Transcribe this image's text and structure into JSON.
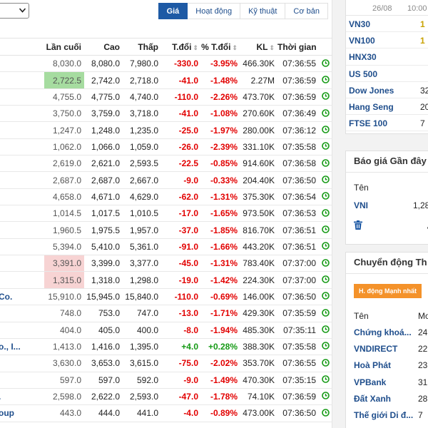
{
  "toolbar": {
    "tabs": [
      {
        "label": "Giá",
        "active": true
      },
      {
        "label": "Hoạt động",
        "active": false
      },
      {
        "label": "Kỹ thuật",
        "active": false
      },
      {
        "label": "Cơ bản",
        "active": false
      }
    ]
  },
  "table": {
    "headers": [
      "Lần cuối",
      "Cao",
      "Thấp",
      "T.đổi",
      "% T.đổi",
      "KL",
      "Thời gian"
    ],
    "rows": [
      {
        "name": "",
        "last": "8,030.0",
        "high": "8,080.0",
        "low": "7,980.0",
        "chg": "-330.0",
        "pct": "-3.95%",
        "vol": "466.30K",
        "time": "07:36:55",
        "hl": ""
      },
      {
        "name": "",
        "last": "2,722.5",
        "high": "2,742.0",
        "low": "2,718.0",
        "chg": "-41.0",
        "pct": "-1.48%",
        "vol": "2.27M",
        "time": "07:36:59",
        "hl": "green"
      },
      {
        "name": "",
        "last": "4,755.0",
        "high": "4,775.0",
        "low": "4,740.0",
        "chg": "-110.0",
        "pct": "-2.26%",
        "vol": "473.70K",
        "time": "07:36:59",
        "hl": ""
      },
      {
        "name": "",
        "last": "3,750.0",
        "high": "3,759.0",
        "low": "3,718.0",
        "chg": "-41.0",
        "pct": "-1.08%",
        "vol": "270.60K",
        "time": "07:36:49",
        "hl": ""
      },
      {
        "name": "",
        "last": "1,247.0",
        "high": "1,248.0",
        "low": "1,235.0",
        "chg": "-25.0",
        "pct": "-1.97%",
        "vol": "280.00K",
        "time": "07:36:12",
        "hl": ""
      },
      {
        "name": "",
        "last": "1,062.0",
        "high": "1,066.0",
        "low": "1,059.0",
        "chg": "-26.0",
        "pct": "-2.39%",
        "vol": "331.10K",
        "time": "07:35:58",
        "hl": ""
      },
      {
        "name": "",
        "last": "2,619.0",
        "high": "2,621.0",
        "low": "2,593.5",
        "chg": "-22.5",
        "pct": "-0.85%",
        "vol": "914.60K",
        "time": "07:36:58",
        "hl": ""
      },
      {
        "name": "",
        "last": "2,687.0",
        "high": "2,687.0",
        "low": "2,667.0",
        "chg": "-9.0",
        "pct": "-0.33%",
        "vol": "204.40K",
        "time": "07:36:50",
        "hl": ""
      },
      {
        "name": "",
        "last": "4,658.0",
        "high": "4,671.0",
        "low": "4,629.0",
        "chg": "-62.0",
        "pct": "-1.31%",
        "vol": "375.30K",
        "time": "07:36:54",
        "hl": ""
      },
      {
        "name": "",
        "last": "1,014.5",
        "high": "1,017.5",
        "low": "1,010.5",
        "chg": "-17.0",
        "pct": "-1.65%",
        "vol": "973.50K",
        "time": "07:36:53",
        "hl": ""
      },
      {
        "name": "",
        "last": "1,960.5",
        "high": "1,975.5",
        "low": "1,957.0",
        "chg": "-37.0",
        "pct": "-1.85%",
        "vol": "816.70K",
        "time": "07:36:51",
        "hl": ""
      },
      {
        "name": "",
        "last": "5,394.0",
        "high": "5,410.0",
        "low": "5,361.0",
        "chg": "-91.0",
        "pct": "-1.66%",
        "vol": "443.20K",
        "time": "07:36:51",
        "hl": ""
      },
      {
        "name": "",
        "last": "3,391.0",
        "high": "3,399.0",
        "low": "3,377.0",
        "chg": "-45.0",
        "pct": "-1.31%",
        "vol": "783.40K",
        "time": "07:37:00",
        "hl": "red"
      },
      {
        "name": "",
        "last": "1,315.0",
        "high": "1,318.0",
        "low": "1,298.0",
        "chg": "-19.0",
        "pct": "-1.42%",
        "vol": "224.30K",
        "time": "07:37:00",
        "hl": "red"
      },
      {
        "name": "Co.",
        "last": "15,910.0",
        "high": "15,945.0",
        "low": "15,840.0",
        "chg": "-110.0",
        "pct": "-0.69%",
        "vol": "146.00K",
        "time": "07:36:50",
        "hl": ""
      },
      {
        "name": "",
        "last": "748.0",
        "high": "753.0",
        "low": "747.0",
        "chg": "-13.0",
        "pct": "-1.71%",
        "vol": "429.30K",
        "time": "07:35:59",
        "hl": ""
      },
      {
        "name": "",
        "last": "404.0",
        "high": "405.0",
        "low": "400.0",
        "chg": "-8.0",
        "pct": "-1.94%",
        "vol": "485.30K",
        "time": "07:35:11",
        "hl": ""
      },
      {
        "name": "o., I...",
        "last": "1,413.0",
        "high": "1,416.0",
        "low": "1,395.0",
        "chg": "+4.0",
        "pct": "+0.28%",
        "vol": "388.30K",
        "time": "07:35:58",
        "hl": ""
      },
      {
        "name": "",
        "last": "3,630.0",
        "high": "3,653.0",
        "low": "3,615.0",
        "chg": "-75.0",
        "pct": "-2.02%",
        "vol": "353.70K",
        "time": "07:36:55",
        "hl": ""
      },
      {
        "name": "",
        "last": "597.0",
        "high": "597.0",
        "low": "592.0",
        "chg": "-9.0",
        "pct": "-1.49%",
        "vol": "470.30K",
        "time": "07:35:15",
        "hl": ""
      },
      {
        "name": ".",
        "last": "2,598.0",
        "high": "2,622.0",
        "low": "2,593.0",
        "chg": "-47.0",
        "pct": "-1.78%",
        "vol": "74.10K",
        "time": "07:36:59",
        "hl": ""
      },
      {
        "name": "oup",
        "last": "443.0",
        "high": "444.0",
        "low": "441.0",
        "chg": "-4.0",
        "pct": "-0.89%",
        "vol": "473.00K",
        "time": "07:36:50",
        "hl": ""
      }
    ]
  },
  "indices": {
    "head_date": "26/08",
    "head_time": "10:00",
    "rows": [
      {
        "name": "VN30",
        "value": "1",
        "accent": true
      },
      {
        "name": "VN100",
        "value": "1",
        "accent": true
      },
      {
        "name": "HNX30",
        "value": "",
        "accent": false
      },
      {
        "name": "US 500",
        "value": "",
        "accent": false
      },
      {
        "name": "Dow Jones",
        "value": "32",
        "accent": false
      },
      {
        "name": "Hang Seng",
        "value": "20",
        "accent": false
      },
      {
        "name": "FTSE 100",
        "value": "7",
        "accent": false
      }
    ]
  },
  "quotes": {
    "title": "Báo giá Gần đây",
    "col_label": "Tên",
    "symbol": "VNI",
    "value": "1,28",
    "edit_glyph": "✓"
  },
  "movers": {
    "title": "Chuyển động Th",
    "button": "H. động Mạnh nhất",
    "col_name": "Tên",
    "col_val": "Mo",
    "rows": [
      {
        "name": "Chứng khoá...",
        "value": "24"
      },
      {
        "name": "VNDIRECT",
        "value": "22"
      },
      {
        "name": "Hoà Phát",
        "value": "23"
      },
      {
        "name": "VPBank",
        "value": "31"
      },
      {
        "name": "Đất Xanh",
        "value": "28"
      },
      {
        "name": "Thế giới Di đ...",
        "value": "7"
      }
    ]
  },
  "colors": {
    "accent": "#1e5aa5",
    "negative": "#e20000",
    "positive": "#159a15",
    "orange": "#f4922a",
    "highlight_up": "#a6dca0",
    "highlight_down": "#f7d3d3"
  }
}
